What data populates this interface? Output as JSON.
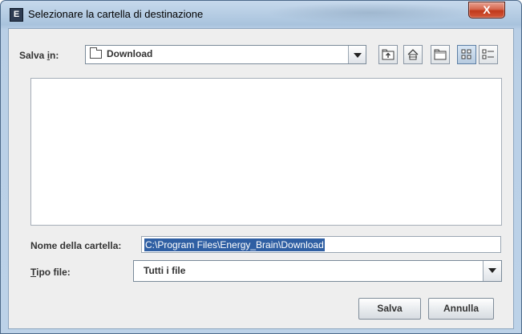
{
  "window": {
    "title": "Selezionare la cartella di destinazione",
    "app_icon_glyph": "E",
    "close_glyph": "X"
  },
  "look_in": {
    "label_prefix": "Salva ",
    "label_mnemonic": "i",
    "label_suffix": "n:",
    "value": "Download"
  },
  "toolbar": {
    "buttons": [
      {
        "name": "up-one-level",
        "icon": "up-folder-icon"
      },
      {
        "name": "home",
        "icon": "home-icon"
      },
      {
        "name": "new-folder",
        "icon": "new-folder-icon"
      },
      {
        "name": "list-view",
        "icon": "list-view-icon",
        "active": true
      },
      {
        "name": "details-view",
        "icon": "details-view-icon"
      }
    ]
  },
  "file_list": {
    "items": []
  },
  "folder_name": {
    "label": "Nome della cartella:",
    "value": "C:\\Program Files\\Energy_Brain\\Download"
  },
  "file_type": {
    "label_mnemonic": "T",
    "label_suffix": "ipo file:",
    "value": "Tutti i file"
  },
  "buttons": {
    "save": "Salva",
    "cancel": "Annulla"
  },
  "colors": {
    "selection": "#2f5fa3",
    "panel": "#eeeeee",
    "title_bar": "#bcd2e8",
    "close_button": "#c0391b"
  }
}
